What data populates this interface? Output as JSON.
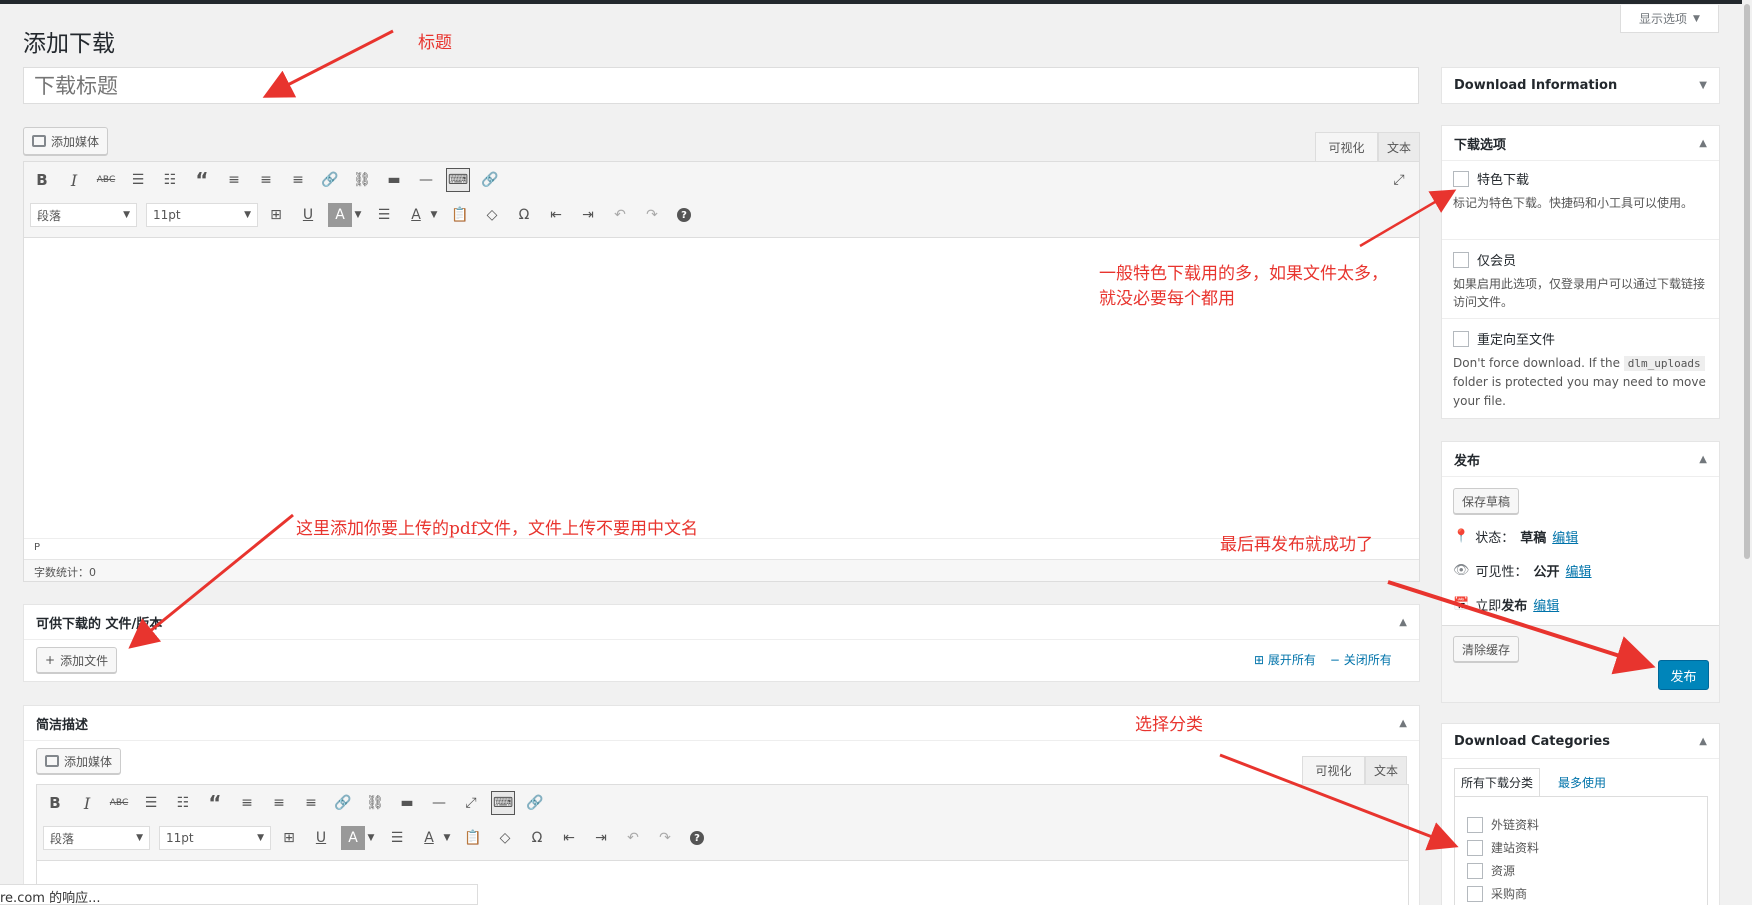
{
  "screen_options": "显示选项",
  "page_title": "添加下载",
  "title_placeholder": "下载标题",
  "add_media": "添加媒体",
  "tab_visual": "可视化",
  "tab_text": "文本",
  "format_select": "段落",
  "size_select": "11pt",
  "path_label": "P",
  "word_count": "字数统计：0",
  "files_box": {
    "title": "可供下载的 文件/版本",
    "add_file": "添加文件",
    "expand_all": "展开所有",
    "close_all": "关闭所有"
  },
  "excerpt_box": {
    "title": "简洁描述"
  },
  "sidebar": {
    "info_title": "Download Information",
    "options_title": "下载选项",
    "featured_label": "特色下载",
    "featured_desc": "标记为特色下载。快捷码和小工具可以使用。",
    "members_label": "仅会员",
    "members_desc": "如果启用此选项，仅登录用户可以通过下载链接访问文件。",
    "redirect_label": "重定向至文件",
    "redirect_desc_1": "Don't force download. If the",
    "redirect_code": "dlm_uploads",
    "redirect_desc_2": "folder is protected you may need to move your file.",
    "publish_title": "发布",
    "save_draft": "保存草稿",
    "status_label": "状态：",
    "status_value": "草稿",
    "visibility_label": "可见性：",
    "visibility_value": "公开",
    "schedule_pre": "立即",
    "schedule_post": "发布",
    "edit_link": "编辑",
    "clear_cache": "清除缓存",
    "publish_button": "发布",
    "categories_title": "Download Categories",
    "cat_tab_all": "所有下载分类",
    "cat_tab_popular": "最多使用",
    "categories": [
      "外链资料",
      "建站资料",
      "资源",
      "采购商"
    ]
  },
  "annotations": {
    "title_note": "标题",
    "featured_note_1": "一般特色下载用的多，如果文件太多，",
    "featured_note_2": "就没必要每个都用",
    "upload_note": "这里添加你要上传的pdf文件，文件上传不要用中文名",
    "publish_note": "最后再发布就成功了",
    "category_note": "选择分类"
  },
  "status_bar": "re.com 的响应...",
  "colors": {
    "accent": "#0073aa",
    "publish": "#0085ba",
    "annotation": "#e8342e"
  }
}
